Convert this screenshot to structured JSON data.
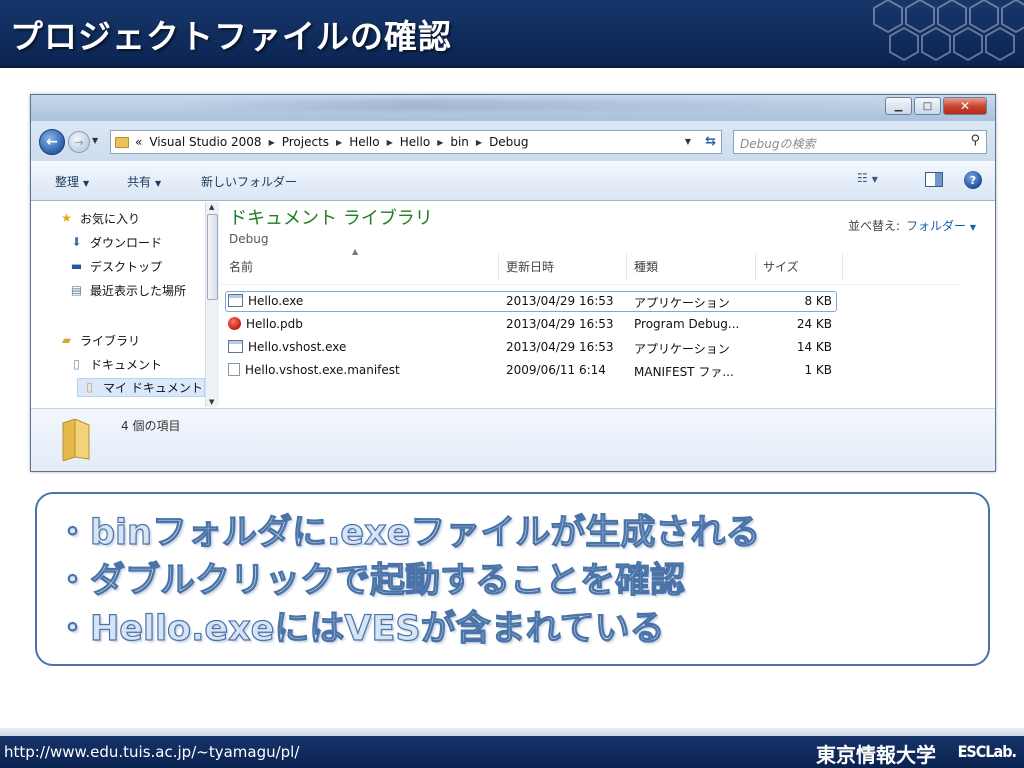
{
  "slide": {
    "title": "プロジェクトファイルの確認",
    "bullets": [
      "・binフォルダに.exeファイルが生成される",
      "・ダブルクリックで起動することを確認",
      "・Hello.exeにはVESが含まれている"
    ],
    "footer_url": "http://www.edu.tuis.ac.jp/~tyamagu/pl/",
    "footer_university": "東京情報大学",
    "footer_lab": "ESCLab."
  },
  "window": {
    "address": {
      "overflow": "«",
      "crumbs": [
        "Visual Studio 2008",
        "Projects",
        "Hello",
        "Hello",
        "bin",
        "Debug"
      ]
    },
    "search_placeholder": "Debugの検索",
    "toolbar": {
      "organize": "整理",
      "share": "共有",
      "new_folder": "新しいフォルダー"
    },
    "nav": {
      "favorites": "お気に入り",
      "downloads": "ダウンロード",
      "desktop": "デスクトップ",
      "recent": "最近表示した場所",
      "libraries": "ライブラリ",
      "documents": "ドキュメント",
      "my_documents": "マイ ドキュメント"
    },
    "library": {
      "title": "ドキュメント ライブラリ",
      "subtitle": "Debug",
      "arrange_label": "並べ替え:",
      "arrange_value": "フォルダー"
    },
    "columns": {
      "name": "名前",
      "date": "更新日時",
      "type": "種類",
      "size": "サイズ"
    },
    "files": [
      {
        "name": "Hello.exe",
        "date": "2013/04/29 16:53",
        "type": "アプリケーション",
        "size": "8 KB",
        "icon": "exe-icon"
      },
      {
        "name": "Hello.pdb",
        "date": "2013/04/29 16:53",
        "type": "Program Debug...",
        "size": "24 KB",
        "icon": "pdb-icon"
      },
      {
        "name": "Hello.vshost.exe",
        "date": "2013/04/29 16:53",
        "type": "アプリケーション",
        "size": "14 KB",
        "icon": "exe-icon"
      },
      {
        "name": "Hello.vshost.exe.manifest",
        "date": "2009/06/11 6:14",
        "type": "MANIFEST ファ...",
        "size": "1 KB",
        "icon": "document-icon"
      }
    ],
    "details": {
      "item_count": "4 個の項目"
    }
  },
  "colors": {
    "header_navy": "#0b2452",
    "library_green": "#1e7f23",
    "bullet_fill": "#d6e4f6",
    "bullet_stroke": "#4a73a8"
  }
}
